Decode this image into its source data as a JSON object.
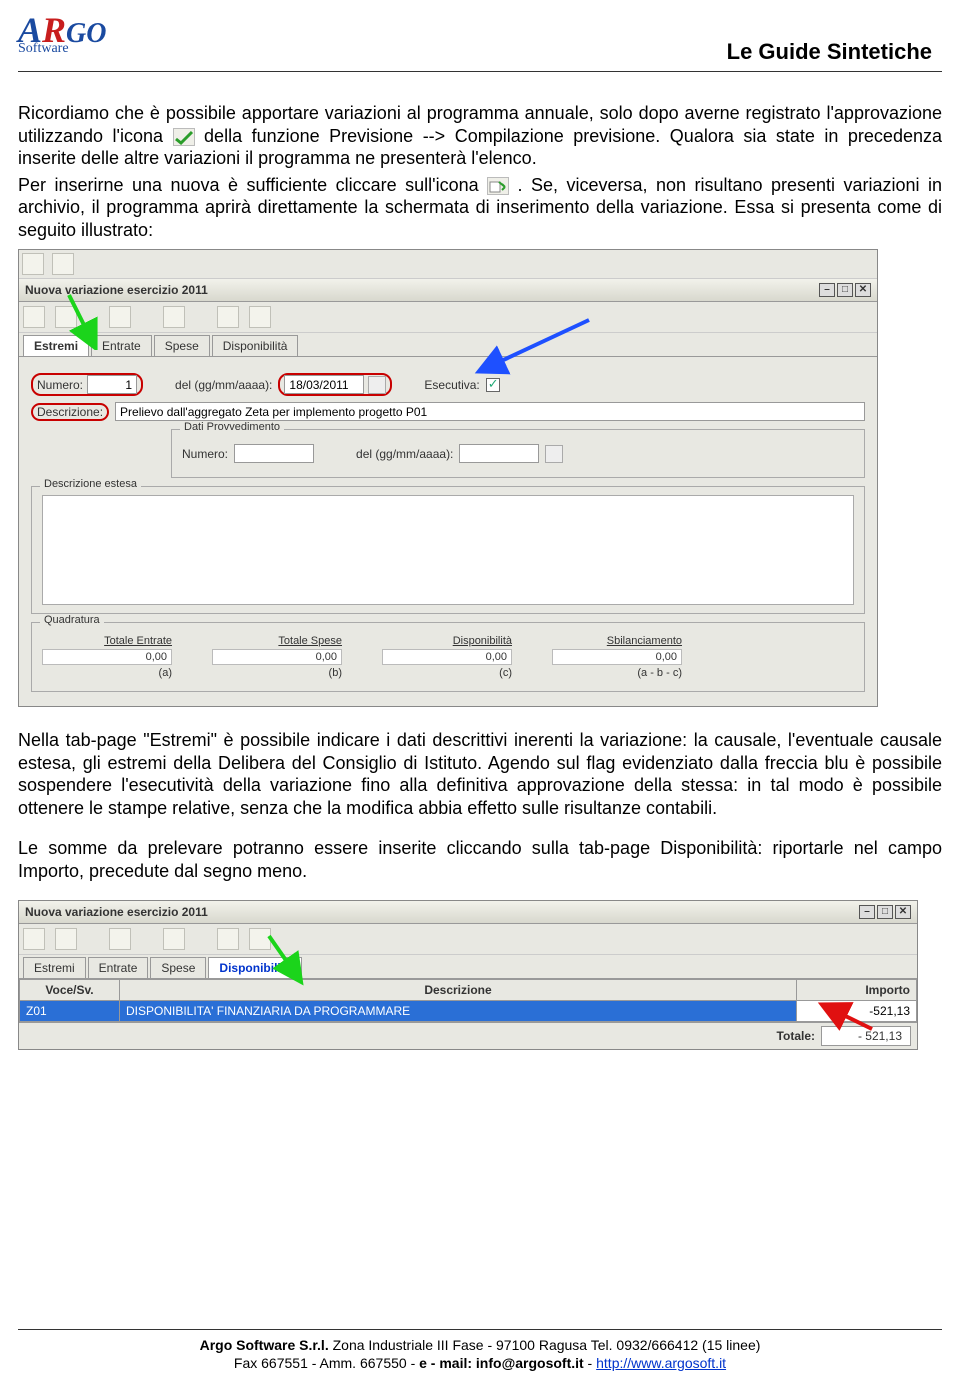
{
  "header": {
    "title": "Le Guide Sintetiche",
    "logo_sw": "Software"
  },
  "para": {
    "p1a": "Ricordiamo che è possibile apportare variazioni al programma annuale, solo dopo averne registrato l'approvazione utilizzando l'icona ",
    "p1b": " della funzione Previsione --> Compilazione previsione. Qualora sia state in precedenza inserite delle altre variazioni il programma ne presenterà l'elenco.",
    "p2a": "Per inserirne una nuova è sufficiente cliccare sull'icona ",
    "p2b": ". Se, viceversa, non risultano presenti variazioni in archivio, il programma aprirà direttamente la schermata di inserimento della variazione. Essa si presenta come di seguito illustrato:",
    "p3": "Nella tab-page \"Estremi\" è possibile indicare i dati descrittivi inerenti la variazione: la causale, l'eventuale causale estesa, gli estremi della Delibera del Consiglio di Istituto. Agendo sul flag evidenziato dalla freccia blu è possibile sospendere l'esecutività della variazione fino alla definitiva approvazione della stessa: in tal modo è possibile ottenere le stampe relative, senza che la modifica abbia effetto sulle risultanze contabili.",
    "p4": "Le somme da prelevare potranno essere inserite cliccando sulla tab-page Disponibilità: riportarle nel campo Importo, precedute dal segno meno."
  },
  "win1": {
    "title": "Nuova variazione esercizio 2011",
    "tabs": [
      "Estremi",
      "Entrate",
      "Spese",
      "Disponibilità"
    ],
    "labels": {
      "numero": "Numero:",
      "del": "del (gg/mm/aaaa):",
      "esecutiva": "Esecutiva:",
      "descrizione": "Descrizione:",
      "dati_provv": "Dati Provvedimento",
      "descr_estesa": "Descrizione estesa",
      "quadratura": "Quadratura"
    },
    "values": {
      "numero": "1",
      "data": "18/03/2011",
      "descrizione": "Prelievo dall'aggregato Zeta per implemento progetto P01",
      "provv_numero": "",
      "provv_data": ""
    },
    "quad": {
      "cols": [
        "Totale Entrate",
        "Totale Spese",
        "Disponibilità",
        "Sbilanciamento"
      ],
      "vals": [
        "0,00",
        "0,00",
        "0,00",
        "0,00"
      ],
      "foot": [
        "(a)",
        "(b)",
        "(c)",
        "(a - b - c)"
      ]
    }
  },
  "win2": {
    "title": "Nuova variazione esercizio 2011",
    "tabs": [
      "Estremi",
      "Entrate",
      "Spese",
      "Disponibilità"
    ],
    "headers": [
      "Voce/Sv.",
      "Descrizione",
      "Importo"
    ],
    "row": {
      "voce": "Z01",
      "descr": "DISPONIBILITA' FINANZIARIA DA PROGRAMMARE",
      "imp": "-521,13"
    },
    "totale_lbl": "Totale:",
    "totale_val": "- 521,13"
  },
  "footer": {
    "l1a": "Argo Software S.r.l.",
    "l1b": " Zona Industriale III Fase - 97100 Ragusa Tel. 0932/666412 (15 linee)",
    "l2a": "Fax 667551 - Amm. 667550 - ",
    "l2b": "e - mail: info@argosoft.it",
    "l2c": " -  ",
    "l2d": "http://www.argosoft.it"
  }
}
